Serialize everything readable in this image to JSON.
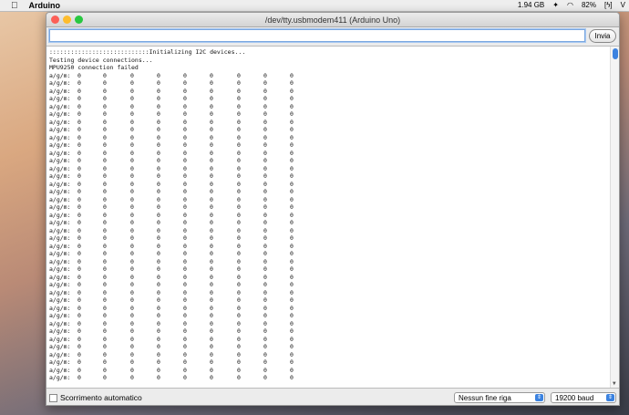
{
  "menubar": {
    "app": "Arduino",
    "memory": "1.94 GB",
    "battery": "82%",
    "clip": "V"
  },
  "window": {
    "title": "/dev/tty.usbmodem411 (Arduino Uno)"
  },
  "send": {
    "value": "",
    "button": "Invia"
  },
  "output": {
    "header_lines": [
      "::::::::::::::::::::::::::::Initializing I2C devices...",
      "Testing device connections...",
      "MPU9250 connection failed"
    ],
    "row_label": "a/g/m:",
    "rows": [
      [
        0,
        0,
        0,
        0,
        0,
        0,
        0,
        0,
        0
      ],
      [
        0,
        0,
        0,
        0,
        0,
        0,
        0,
        0,
        0
      ],
      [
        0,
        0,
        0,
        0,
        0,
        0,
        0,
        0,
        0
      ],
      [
        0,
        0,
        0,
        0,
        0,
        0,
        0,
        0,
        0
      ],
      [
        0,
        0,
        0,
        0,
        0,
        0,
        0,
        0,
        0
      ],
      [
        0,
        0,
        0,
        0,
        0,
        0,
        0,
        0,
        0
      ],
      [
        0,
        0,
        0,
        0,
        0,
        0,
        0,
        0,
        0
      ],
      [
        0,
        0,
        0,
        0,
        0,
        0,
        0,
        0,
        0
      ],
      [
        0,
        0,
        0,
        0,
        0,
        0,
        0,
        0,
        0
      ],
      [
        0,
        0,
        0,
        0,
        0,
        0,
        0,
        0,
        0
      ],
      [
        0,
        0,
        0,
        0,
        0,
        0,
        0,
        0,
        0
      ],
      [
        0,
        0,
        0,
        0,
        0,
        0,
        0,
        0,
        0
      ],
      [
        0,
        0,
        0,
        0,
        0,
        0,
        0,
        0,
        0
      ],
      [
        0,
        0,
        0,
        0,
        0,
        0,
        0,
        0,
        0
      ],
      [
        0,
        0,
        0,
        0,
        0,
        0,
        0,
        0,
        0
      ],
      [
        0,
        0,
        0,
        0,
        0,
        0,
        0,
        0,
        0
      ],
      [
        0,
        0,
        0,
        0,
        0,
        0,
        0,
        0,
        0
      ],
      [
        0,
        0,
        0,
        0,
        0,
        0,
        0,
        0,
        0
      ],
      [
        0,
        0,
        0,
        0,
        0,
        0,
        0,
        0,
        0
      ],
      [
        0,
        0,
        0,
        0,
        0,
        0,
        0,
        0,
        0
      ],
      [
        0,
        0,
        0,
        0,
        0,
        0,
        0,
        0,
        0
      ],
      [
        0,
        0,
        0,
        0,
        0,
        0,
        0,
        0,
        0
      ],
      [
        0,
        0,
        0,
        0,
        0,
        0,
        0,
        0,
        0
      ],
      [
        0,
        0,
        0,
        0,
        0,
        0,
        0,
        0,
        0
      ],
      [
        0,
        0,
        0,
        0,
        0,
        0,
        0,
        0,
        0
      ],
      [
        0,
        0,
        0,
        0,
        0,
        0,
        0,
        0,
        0
      ],
      [
        0,
        0,
        0,
        0,
        0,
        0,
        0,
        0,
        0
      ],
      [
        0,
        0,
        0,
        0,
        0,
        0,
        0,
        0,
        0
      ],
      [
        0,
        0,
        0,
        0,
        0,
        0,
        0,
        0,
        0
      ],
      [
        0,
        0,
        0,
        0,
        0,
        0,
        0,
        0,
        0
      ],
      [
        0,
        0,
        0,
        0,
        0,
        0,
        0,
        0,
        0
      ],
      [
        0,
        0,
        0,
        0,
        0,
        0,
        0,
        0,
        0
      ],
      [
        0,
        0,
        0,
        0,
        0,
        0,
        0,
        0,
        0
      ],
      [
        0,
        0,
        0,
        0,
        0,
        0,
        0,
        0,
        0
      ],
      [
        0,
        0,
        0,
        0,
        0,
        0,
        0,
        0,
        0
      ],
      [
        0,
        0,
        0,
        0,
        0,
        0,
        0,
        0,
        0
      ],
      [
        0,
        0,
        0,
        0,
        0,
        0,
        0,
        0,
        0
      ],
      [
        0,
        0,
        0,
        0,
        0,
        0,
        0,
        0,
        0
      ],
      [
        0,
        0,
        0,
        0,
        0,
        0,
        0,
        0,
        0
      ],
      [
        0,
        0,
        0,
        0,
        0,
        0,
        0,
        0,
        0
      ]
    ]
  },
  "bottom": {
    "autoscroll_label": "Scorrimento automatico",
    "autoscroll_checked": false,
    "line_ending": "Nessun fine riga",
    "baud": "19200 baud"
  }
}
